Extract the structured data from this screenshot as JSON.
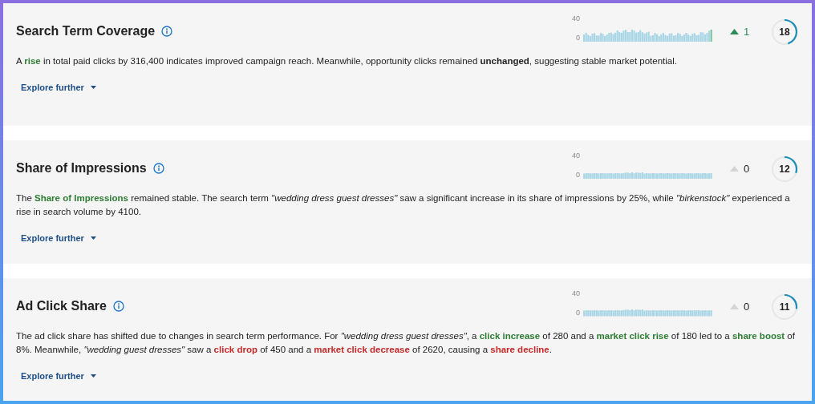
{
  "cards": [
    {
      "title": "Search Term Coverage",
      "axis_max": "40",
      "axis_min": "0",
      "rising": true,
      "change": "1",
      "score": "18",
      "description": [
        {
          "text": "A ",
          "kind": "plain"
        },
        {
          "text": "rise",
          "kind": "positive"
        },
        {
          "text": " in total paid clicks by 316,400 indicates improved campaign reach. Meanwhile, opportunity clicks remained ",
          "kind": "plain"
        },
        {
          "text": "unchanged",
          "kind": "bold"
        },
        {
          "text": ", suggesting stable market potential.",
          "kind": "plain"
        }
      ],
      "action": "Explore further"
    },
    {
      "title": "Share of Impressions",
      "axis_max": "40",
      "axis_min": "0",
      "rising": false,
      "change": "0",
      "score": "12",
      "description": [
        {
          "text": "The ",
          "kind": "plain"
        },
        {
          "text": "Share of Impressions",
          "kind": "positive"
        },
        {
          "text": " remained stable. The search term ",
          "kind": "plain"
        },
        {
          "text": "\"wedding dress guest dresses\"",
          "kind": "italic"
        },
        {
          "text": " saw a significant increase in its share of impressions by 25%, while ",
          "kind": "plain"
        },
        {
          "text": "\"birkenstock\"",
          "kind": "italic"
        },
        {
          "text": " experienced a rise in search volume by 4100.",
          "kind": "plain"
        }
      ],
      "action": "Explore further"
    },
    {
      "title": "Ad Click Share",
      "axis_max": "40",
      "axis_min": "0",
      "rising": false,
      "change": "0",
      "score": "11",
      "description": [
        {
          "text": "The ad click share has shifted due to changes in search term performance. For ",
          "kind": "plain"
        },
        {
          "text": "\"wedding dress guest dresses\"",
          "kind": "italic"
        },
        {
          "text": ", a ",
          "kind": "plain"
        },
        {
          "text": "click increase",
          "kind": "positive"
        },
        {
          "text": " of 280 and a ",
          "kind": "plain"
        },
        {
          "text": "market click rise",
          "kind": "positive"
        },
        {
          "text": " of 180 led to a ",
          "kind": "plain"
        },
        {
          "text": "share boost",
          "kind": "positive"
        },
        {
          "text": " of 8%. Meanwhile, ",
          "kind": "plain"
        },
        {
          "text": "\"wedding guest dresses\"",
          "kind": "italic"
        },
        {
          "text": " saw a ",
          "kind": "plain"
        },
        {
          "text": "click drop",
          "kind": "negative"
        },
        {
          "text": " of 450 and a ",
          "kind": "plain"
        },
        {
          "text": "market click decrease",
          "kind": "negative"
        },
        {
          "text": " of 2620, causing a ",
          "kind": "plain"
        },
        {
          "text": "share decline",
          "kind": "negative"
        },
        {
          "text": ".",
          "kind": "plain"
        }
      ],
      "action": "Explore further"
    }
  ]
}
